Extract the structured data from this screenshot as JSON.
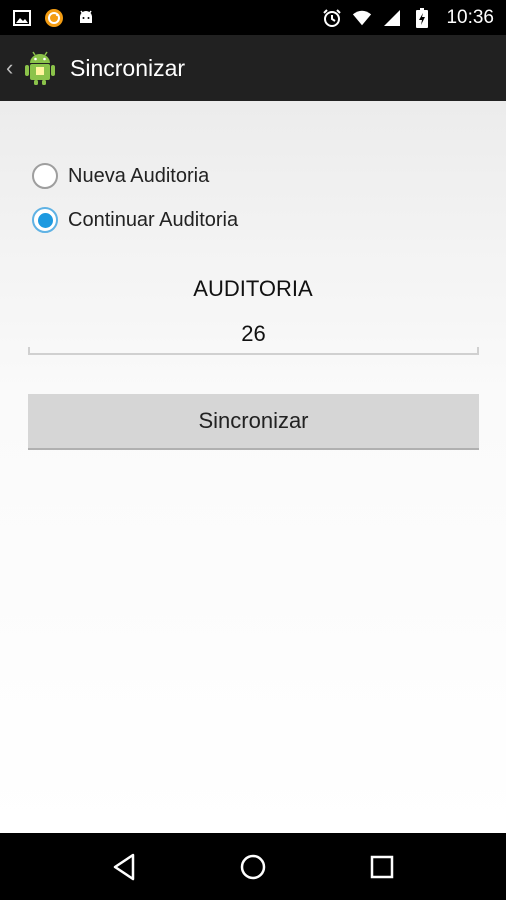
{
  "status_bar": {
    "time": "10:36",
    "left_icons": [
      "image-icon",
      "sync-app-icon",
      "android-debug-icon"
    ],
    "right_icons": [
      "alarm-icon",
      "wifi-icon",
      "signal-icon",
      "battery-icon"
    ]
  },
  "action_bar": {
    "title": "Sincronizar",
    "logo": "android-app-icon"
  },
  "form": {
    "radio_options": [
      {
        "label": "Nueva Auditoria",
        "checked": false
      },
      {
        "label": "Continuar Auditoria",
        "checked": true
      }
    ],
    "audit_label": "AUDITORIA",
    "audit_value": "26",
    "sync_button_label": "Sincronizar"
  },
  "nav_bar": {
    "buttons": [
      "back-icon",
      "home-icon",
      "recents-icon"
    ]
  },
  "colors": {
    "accent": "#1e9ae0",
    "action_bar": "#212121",
    "button_bg": "#d6d6d6"
  }
}
